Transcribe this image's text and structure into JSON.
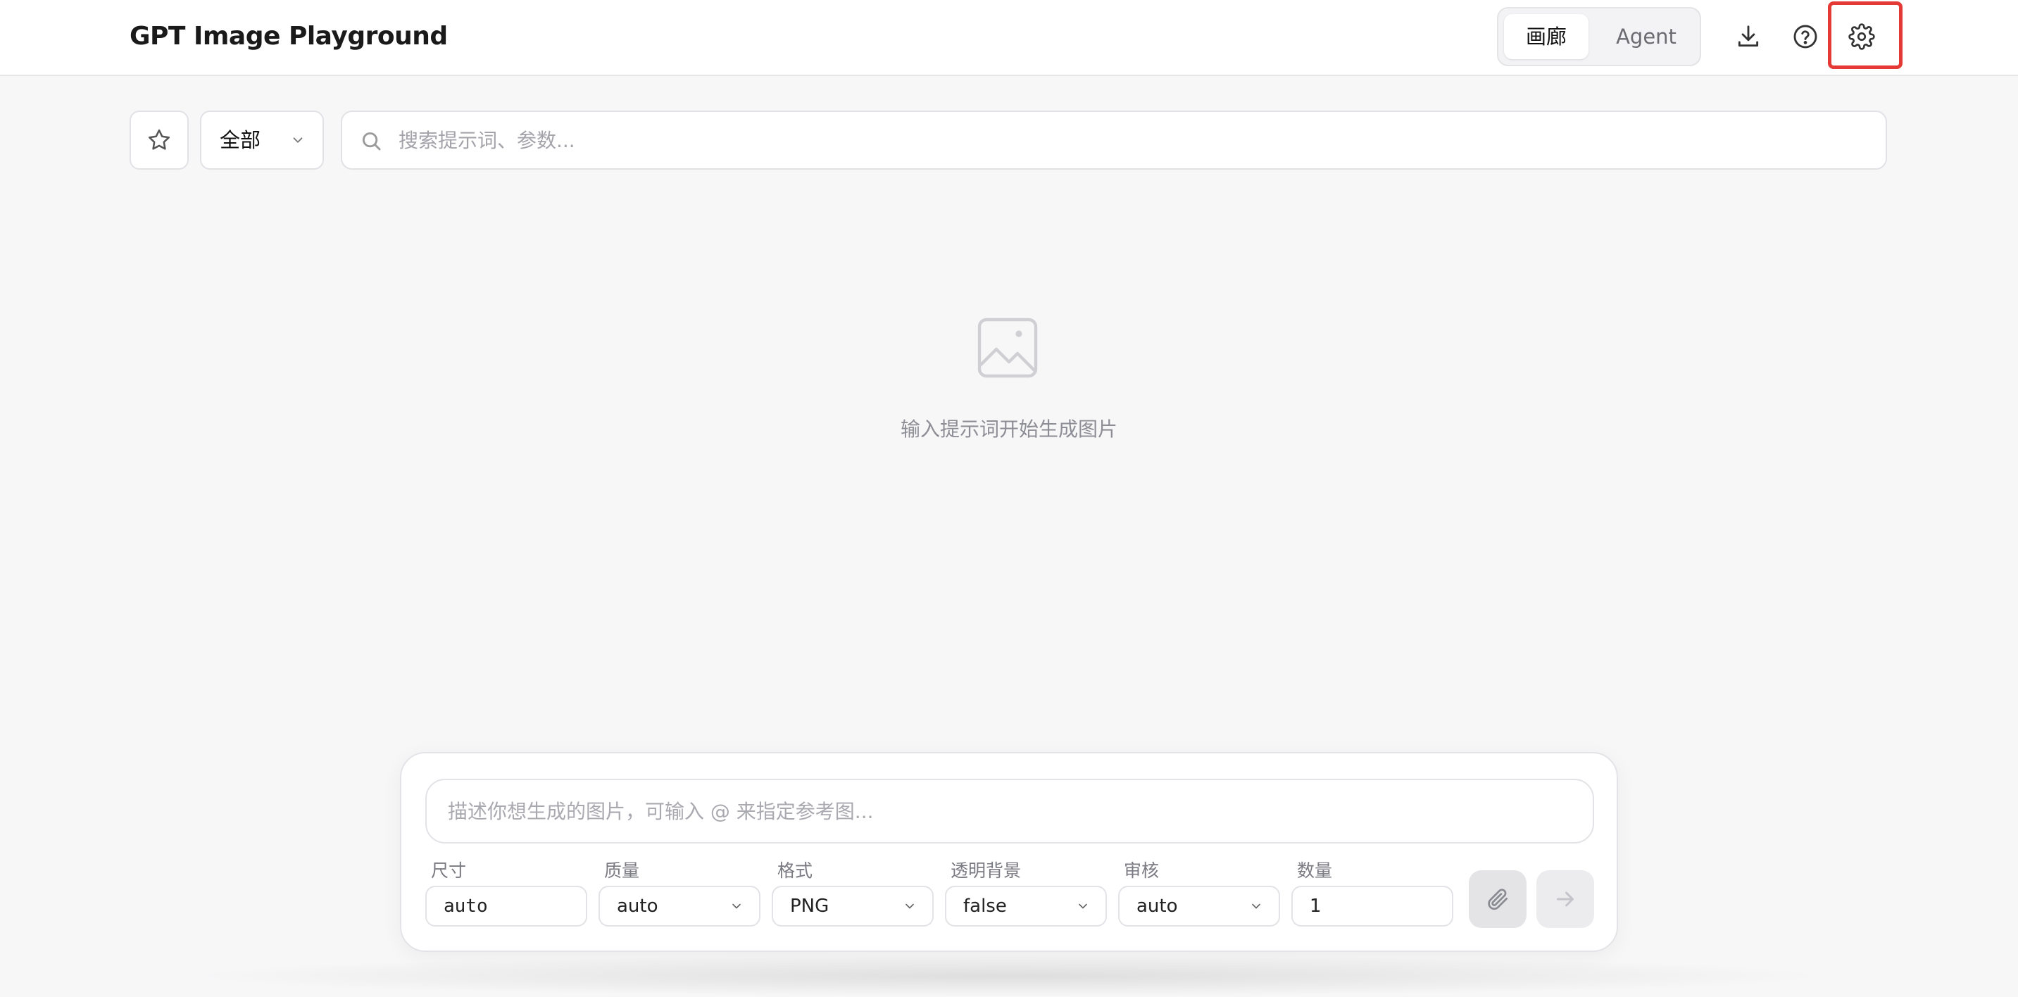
{
  "header": {
    "title": "GPT Image Playground",
    "tabs": [
      {
        "label": "画廊",
        "active": true
      },
      {
        "label": "Agent",
        "active": false
      }
    ],
    "icons": [
      "download-icon",
      "help-icon",
      "gear-icon"
    ]
  },
  "filter": {
    "favorite_icon": "star-icon",
    "category_selected": "全部",
    "search_placeholder": "搜索提示词、参数..."
  },
  "empty_state": {
    "icon": "image-placeholder-icon",
    "message": "输入提示词开始生成图片"
  },
  "composer": {
    "prompt_placeholder": "描述你想生成的图片，可输入 @ 来指定参考图...",
    "params": [
      {
        "label": "尺寸",
        "value": "auto"
      },
      {
        "label": "质量",
        "value": "auto"
      },
      {
        "label": "格式",
        "value": "PNG"
      },
      {
        "label": "透明背景",
        "value": "false"
      },
      {
        "label": "审核",
        "value": "auto"
      },
      {
        "label": "数量",
        "value": "1"
      }
    ],
    "attach_icon": "paperclip-icon",
    "send_icon": "arrow-right-icon"
  },
  "colors": {
    "highlight": "#e53935",
    "background": "#f7f7f8",
    "muted_text": "#8d8d95"
  }
}
